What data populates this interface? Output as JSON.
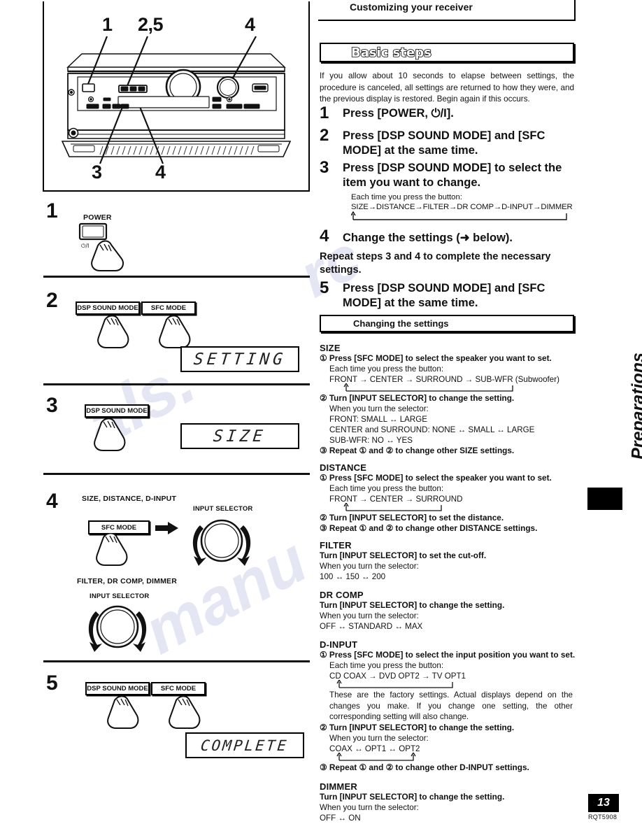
{
  "page": {
    "number": "13",
    "doc_code": "RQT5908",
    "side_tab": "Preparations"
  },
  "header": {
    "chapter_title": "Customizing your receiver",
    "section_band": "Basic steps",
    "intro": "If you allow about 10 seconds to elapse between settings, the procedure is canceled, all settings are returned to how they were, and the previous display is restored. Begin again if this occurs."
  },
  "steps": [
    {
      "num": "1",
      "text": "Press [POWER, ⏻/I]."
    },
    {
      "num": "2",
      "text": "Press [DSP SOUND MODE] and [SFC MODE] at the same time."
    },
    {
      "num": "3",
      "text": "Press [DSP SOUND MODE] to select the item you want to change.",
      "note_label": "Each time you press the button:",
      "flow": "SIZE→DISTANCE→FILTER→DR COMP→D-INPUT→DIMMER"
    },
    {
      "num": "4",
      "text": "Change the settings (➜ below)."
    },
    {
      "num": "5",
      "text": "Press [DSP SOUND MODE] and [SFC MODE] at the same time."
    }
  ],
  "repeat_note": "Repeat steps 3 and 4 to complete the necessary settings.",
  "changing_band": "Changing the settings",
  "settings": [
    {
      "name": "SIZE",
      "lines": [
        {
          "style": "bold",
          "text": "① Press [SFC MODE] to select the speaker you want to set."
        },
        {
          "style": "normal-indent",
          "text": "Each time you press the button:"
        },
        {
          "style": "normal-indent",
          "text": "FRONT → CENTER → SURROUND → SUB-WFR (Subwoofer)"
        },
        {
          "style": "loop",
          "text": ""
        },
        {
          "style": "bold",
          "text": "② Turn [INPUT SELECTOR] to change the setting."
        },
        {
          "style": "normal-indent",
          "text": "When you turn the selector:"
        },
        {
          "style": "normal-indent",
          "text": "FRONT:  SMALL ↔ LARGE"
        },
        {
          "style": "normal-indent",
          "text": "CENTER and SURROUND: NONE ↔ SMALL ↔ LARGE"
        },
        {
          "style": "normal-indent",
          "text": "SUB-WFR: NO ↔ YES"
        },
        {
          "style": "bold",
          "text": "③ Repeat ① and ② to change other SIZE settings."
        }
      ]
    },
    {
      "name": "DISTANCE",
      "lines": [
        {
          "style": "bold",
          "text": "① Press [SFC MODE] to select the speaker you want to set."
        },
        {
          "style": "normal-indent",
          "text": "Each time you press the button:"
        },
        {
          "style": "normal-indent",
          "text": "FRONT → CENTER → SURROUND"
        },
        {
          "style": "loop",
          "text": ""
        },
        {
          "style": "bold",
          "text": "② Turn [INPUT SELECTOR] to set the distance."
        },
        {
          "style": "bold",
          "text": "③ Repeat ① and ② to change other DISTANCE settings."
        }
      ]
    },
    {
      "name": "FILTER",
      "lines": [
        {
          "style": "bold",
          "text": "Turn [INPUT SELECTOR] to set the cut-off."
        },
        {
          "style": "normal",
          "text": "When you turn the selector:"
        },
        {
          "style": "normal",
          "text": "100 ↔ 150 ↔ 200"
        }
      ]
    },
    {
      "name": "DR COMP",
      "lines": [
        {
          "style": "bold",
          "text": "Turn [INPUT SELECTOR] to change the setting."
        },
        {
          "style": "normal",
          "text": "When you turn the selector:"
        },
        {
          "style": "normal",
          "text": "OFF ↔ STANDARD ↔ MAX"
        }
      ]
    },
    {
      "name": "D-INPUT",
      "lines": [
        {
          "style": "bold",
          "text": "① Press [SFC MODE] to select the input position you want to set."
        },
        {
          "style": "normal-indent",
          "text": "Each time you press the button:"
        },
        {
          "style": "normal-indent",
          "text": "CD COAX →  DVD OPT2 → TV OPT1"
        },
        {
          "style": "loop",
          "text": ""
        },
        {
          "style": "para",
          "text": "These are the factory settings. Actual displays depend on the changes you make. If you change one setting, the other corresponding setting will also change."
        },
        {
          "style": "bold",
          "text": "② Turn [INPUT SELECTOR] to change the setting."
        },
        {
          "style": "normal-indent",
          "text": "When you turn the selector:"
        },
        {
          "style": "normal-indent",
          "text": "COAX ↔ OPT1 ↔ OPT2"
        },
        {
          "style": "loop",
          "text": ""
        },
        {
          "style": "bold",
          "text": "③ Repeat ① and ② to change other D-INPUT settings."
        }
      ]
    },
    {
      "name": "DIMMER",
      "lines": [
        {
          "style": "bold",
          "text": "Turn [INPUT SELECTOR] to change the setting."
        },
        {
          "style": "normal",
          "text": "When you turn the selector:"
        },
        {
          "style": "normal",
          "text": "OFF ↔ ON"
        }
      ]
    }
  ],
  "illustration": {
    "callouts_top": [
      "1",
      "2,5",
      "4"
    ],
    "callouts_bottom": [
      "3",
      "4"
    ]
  },
  "figures": {
    "step1": {
      "num": "1",
      "button_label": "POWER",
      "button_symbol": "⏻/I"
    },
    "step2": {
      "num": "2",
      "buttons": [
        "DSP SOUND MODE",
        "SFC MODE"
      ],
      "display": "SETTING"
    },
    "step3": {
      "num": "3",
      "buttons": [
        "DSP SOUND MODE"
      ],
      "display": "SIZE"
    },
    "step4": {
      "num": "4",
      "group_a_label": "SIZE, DISTANCE, D-INPUT",
      "group_a_button": "SFC MODE",
      "group_a_knob": "INPUT SELECTOR",
      "group_b_label": "FILTER, DR COMP, DIMMER",
      "group_b_knob": "INPUT SELECTOR"
    },
    "step5": {
      "num": "5",
      "buttons": [
        "DSP SOUND MODE",
        "SFC MODE"
      ],
      "display": "COMPLETE"
    }
  },
  "colors": {
    "ink": "#111111",
    "paper": "#ffffff"
  }
}
